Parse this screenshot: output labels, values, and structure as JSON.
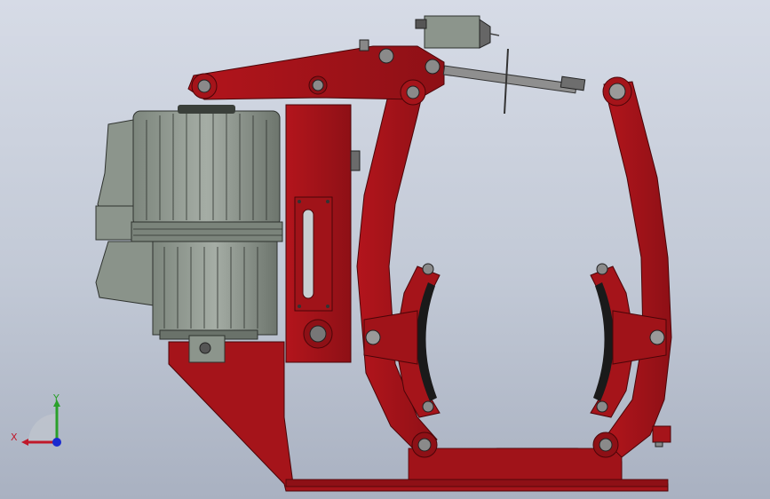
{
  "colors": {
    "background_top": "#d6dbe6",
    "background_bottom": "#a9b1c1",
    "frame_red": "#a5141a",
    "frame_red_dark": "#6e0a0e",
    "motor_gray": "#8c958c",
    "motor_gray_dark": "#4e544e",
    "pad_black": "#1a1a1a",
    "axis_x": "#c0182a",
    "axis_y": "#2aa02a",
    "axis_origin": "#1a2ad0"
  },
  "triad": {
    "x_label": "X",
    "y_label": "Y"
  },
  "icons": {
    "orientation": "view-orientation-triad-icon"
  }
}
